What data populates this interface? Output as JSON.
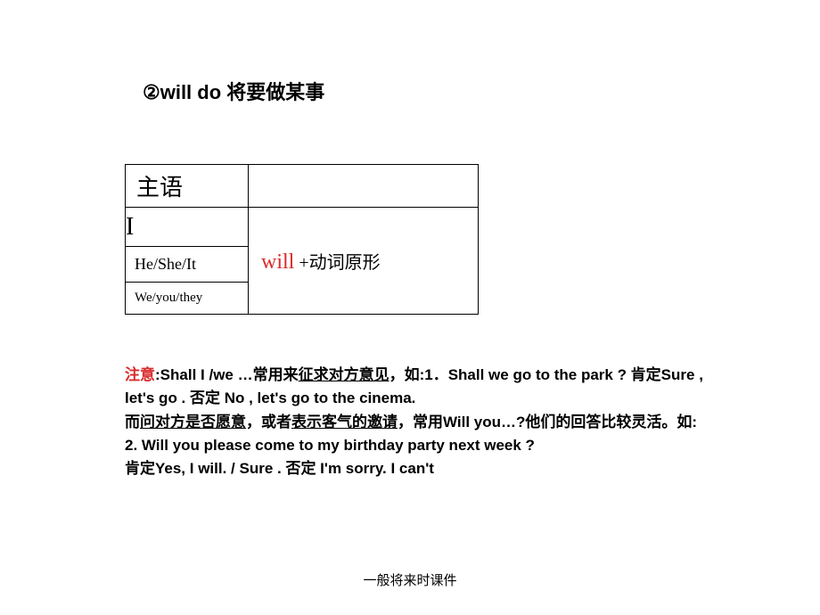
{
  "heading": "②will do 将要做某事",
  "table": {
    "subject_header": "主语",
    "right_header": "",
    "rows": {
      "i": "I",
      "hesheit": "He/She/It",
      "weyouthey": "We/you/they"
    },
    "formula": {
      "will": "will",
      "rest": " +动词原形"
    }
  },
  "note": {
    "label": "注意",
    "colon1": ":",
    "p1a": "Shall I /we …常用来",
    "p1b_u": "征求对方意见",
    "p1c": "，如:1．Shall we go to the park ?  肯定Sure , let's go .   否定 No , let's go to the cinema.",
    "p2a": "而",
    "p2b_u": "问对方是否愿意",
    "p2c": "，或者",
    "p2d_u": "表示客气的邀请",
    "p2e": "，常用Will you…?他们的回答比较灵活。如:",
    "p3": "2.  Will you please come to my birthday party next week ?",
    "p4": "  肯定Yes, I will. / Sure .   否定 I'm sorry. I can't"
  },
  "footer": "一般将来时课件"
}
